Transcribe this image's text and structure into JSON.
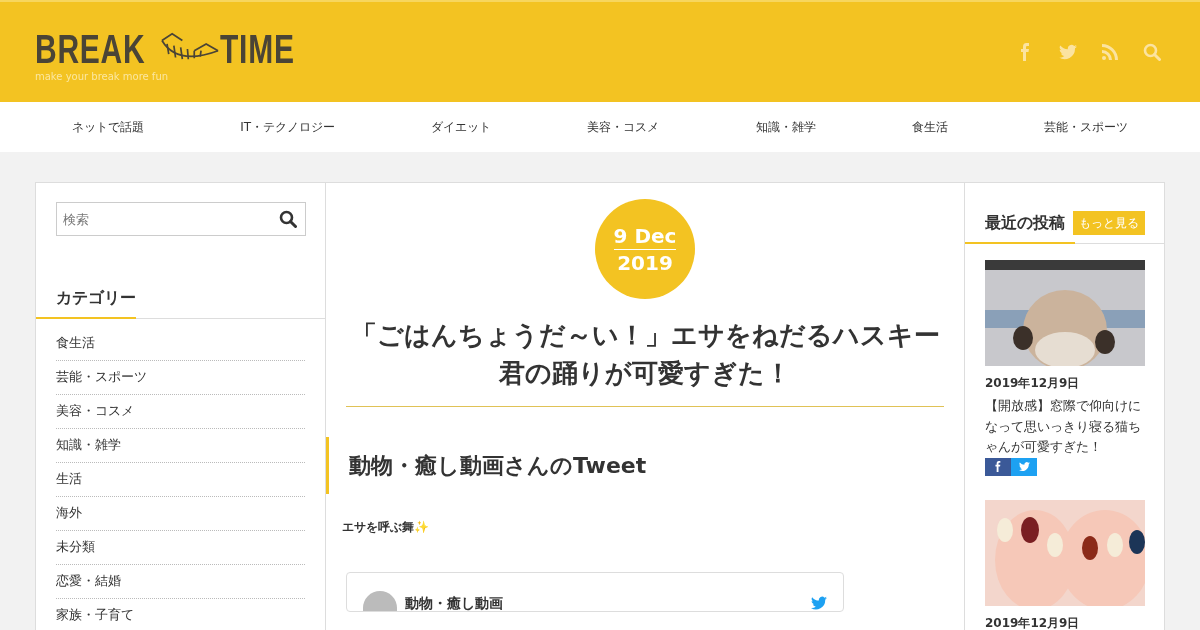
{
  "header": {
    "logo_left": "BREAK",
    "logo_right": "TIME",
    "tagline": "make your break more fun"
  },
  "social": [
    {
      "kind": "facebook"
    },
    {
      "kind": "twitter"
    },
    {
      "kind": "rss"
    },
    {
      "kind": "search"
    }
  ],
  "nav": [
    "ネットで話題",
    "IT・テクノロジー",
    "ダイエット",
    "美容・コスメ",
    "知識・雑学",
    "食生活",
    "芸能・スポーツ"
  ],
  "sidebar": {
    "search": {
      "placeholder": "検索"
    },
    "heading": "カテゴリー",
    "categories": [
      "食生活",
      "芸能・スポーツ",
      "美容・コスメ",
      "知識・雑学",
      "生活",
      "海外",
      "未分類",
      "恋愛・結婚",
      "家族・子育て"
    ]
  },
  "article": {
    "date_day": "9 Dec",
    "date_year": "2019",
    "title": "「ごはんちょうだ～い！」エサをねだるハスキー君の踊りが可愛すぎた！",
    "section_heading": "動物・癒し動画さんのTweet",
    "lead": "エサを呼ぶ舞",
    "lead_emoji": "✨",
    "tweet": {
      "name": "動物・癒し動画"
    }
  },
  "recent": {
    "heading": "最近の投稿",
    "more": "もっと見る",
    "posts": [
      {
        "date": "2019年12月9日",
        "title": "【開放感】窓際で仰向けになって思いっきり寝る猫ちゃんが可愛すぎた！",
        "share": true,
        "kind": "picture"
      },
      {
        "date": "2019年12月9日",
        "kind": "picture"
      }
    ]
  }
}
